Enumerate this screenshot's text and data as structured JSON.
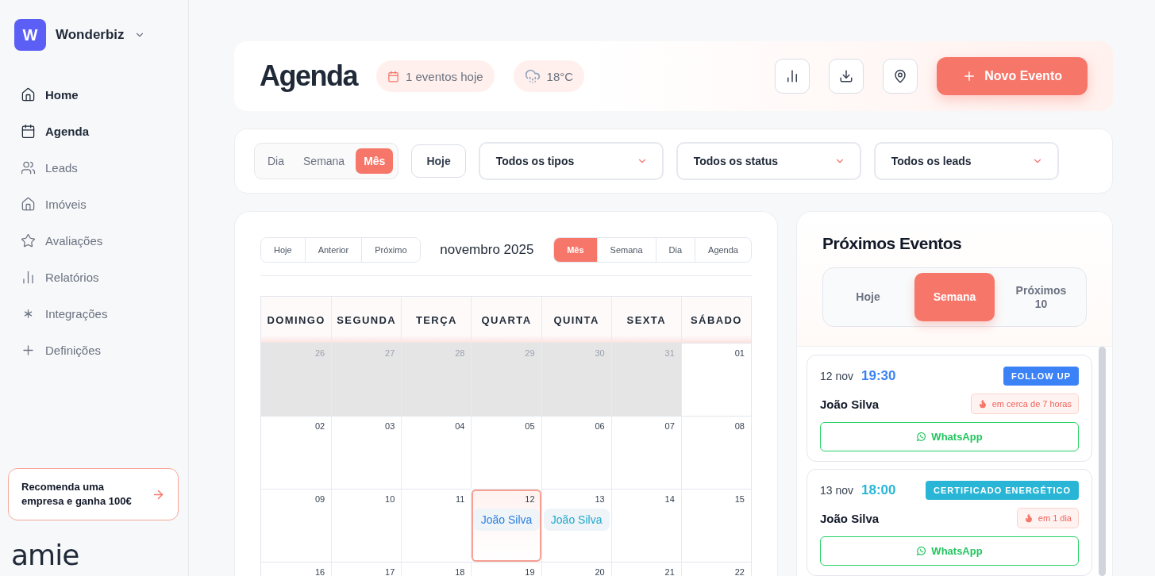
{
  "sidebar": {
    "brand": {
      "initial": "W",
      "name": "Wonderbiz"
    },
    "items": [
      {
        "label": "Home",
        "selected": true
      },
      {
        "label": "Agenda",
        "selected": true
      },
      {
        "label": "Leads",
        "selected": false
      },
      {
        "label": "Imóveis",
        "selected": false
      },
      {
        "label": "Avaliações",
        "selected": false
      },
      {
        "label": "Relatórios",
        "selected": false
      },
      {
        "label": "Integrações",
        "selected": false
      },
      {
        "label": "Definições",
        "selected": false
      }
    ],
    "promo": "Recomenda uma empresa e ganha 100€",
    "logo": "amie"
  },
  "header": {
    "title": "Agenda",
    "events_badge": "1 eventos hoje",
    "weather": "18°C",
    "new_event": "Novo Evento"
  },
  "filters": {
    "views": [
      {
        "label": "Dia",
        "selected": false
      },
      {
        "label": "Semana",
        "selected": false
      },
      {
        "label": "Mês",
        "selected": true
      }
    ],
    "today": "Hoje",
    "dropdowns": [
      "Todos os tipos",
      "Todos os status",
      "Todos os leads"
    ]
  },
  "calendar": {
    "nav": [
      "Hoje",
      "Anterior",
      "Próximo"
    ],
    "month": "novembro 2025",
    "views": [
      {
        "label": "Mês",
        "selected": true
      },
      {
        "label": "Semana",
        "selected": false
      },
      {
        "label": "Dia",
        "selected": false
      },
      {
        "label": "Agenda",
        "selected": false
      }
    ],
    "weekdays": [
      "DOMINGO",
      "SEGUNDA",
      "TERÇA",
      "QUARTA",
      "QUINTA",
      "SEXTA",
      "SÁBADO"
    ],
    "weeks": [
      [
        {
          "day": "26",
          "outside": true,
          "today": false
        },
        {
          "day": "27",
          "outside": true,
          "today": false
        },
        {
          "day": "28",
          "outside": true,
          "today": false
        },
        {
          "day": "29",
          "outside": true,
          "today": false
        },
        {
          "day": "30",
          "outside": true,
          "today": false
        },
        {
          "day": "31",
          "outside": true,
          "today": false
        },
        {
          "day": "01",
          "outside": false,
          "today": false
        }
      ],
      [
        {
          "day": "02",
          "outside": false,
          "today": false
        },
        {
          "day": "03",
          "outside": false,
          "today": false
        },
        {
          "day": "04",
          "outside": false,
          "today": false
        },
        {
          "day": "05",
          "outside": false,
          "today": false
        },
        {
          "day": "06",
          "outside": false,
          "today": false
        },
        {
          "day": "07",
          "outside": false,
          "today": false
        },
        {
          "day": "08",
          "outside": false,
          "today": false
        }
      ],
      [
        {
          "day": "09",
          "outside": false,
          "today": false
        },
        {
          "day": "10",
          "outside": false,
          "today": false
        },
        {
          "day": "11",
          "outside": false,
          "today": false
        },
        {
          "day": "12",
          "outside": false,
          "today": true,
          "events": [
            {
              "name": "João Silva",
              "color": "#2f7fe0"
            }
          ]
        },
        {
          "day": "13",
          "outside": false,
          "today": false,
          "events": [
            {
              "name": "João Silva",
              "color": "#22a9cc"
            }
          ]
        },
        {
          "day": "14",
          "outside": false,
          "today": false
        },
        {
          "day": "15",
          "outside": false,
          "today": false
        }
      ],
      [
        {
          "day": "16",
          "outside": false,
          "today": false
        },
        {
          "day": "17",
          "outside": false,
          "today": false
        },
        {
          "day": "18",
          "outside": false,
          "today": false
        },
        {
          "day": "19",
          "outside": false,
          "today": false
        },
        {
          "day": "20",
          "outside": false,
          "today": false
        },
        {
          "day": "21",
          "outside": false,
          "today": false
        },
        {
          "day": "22",
          "outside": false,
          "today": false
        }
      ]
    ]
  },
  "upcoming": {
    "title": "Próximos Eventos",
    "tabs": [
      {
        "label": "Hoje",
        "selected": false
      },
      {
        "label": "Semana",
        "selected": true
      },
      {
        "label": "Próximos 10",
        "selected": false
      }
    ],
    "events": [
      {
        "date": "12 nov",
        "time": "19:30",
        "type": "FOLLOW UP",
        "color": "#3b82f6",
        "person": "João Silva",
        "relative": "em cerca de 7 horas",
        "action": "WhatsApp"
      },
      {
        "date": "13 nov",
        "time": "18:00",
        "type": "CERTIFICADO ENERGÉTICO",
        "color": "#29b6d6",
        "person": "João Silva",
        "relative": "em 1 dia",
        "action": "WhatsApp"
      }
    ]
  }
}
